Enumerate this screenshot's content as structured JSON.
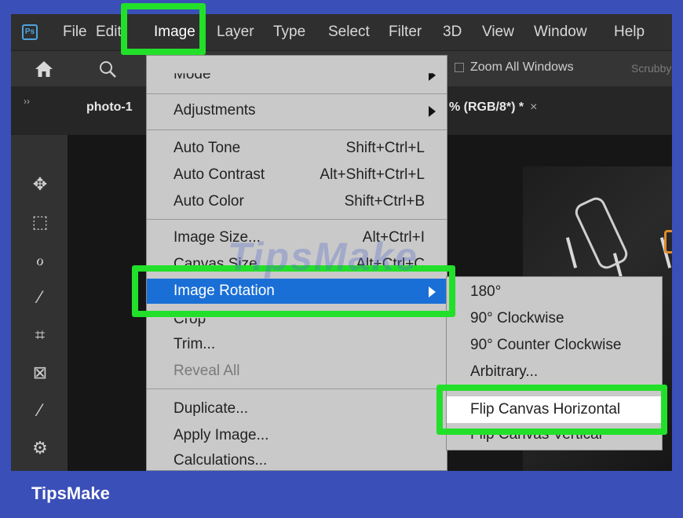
{
  "menubar": {
    "logo": "Ps",
    "items": [
      "File",
      "Edit",
      "Image",
      "Layer",
      "Type",
      "Select",
      "Filter",
      "3D",
      "View",
      "Window",
      "Help"
    ],
    "active": "Image"
  },
  "options": {
    "zoom_all_windows": "Zoom All Windows",
    "scrubby": "Scrubby"
  },
  "tabs": {
    "doc1": "photo-1",
    "doc2": "% (RGB/8*) *",
    "close": "×"
  },
  "image_menu": {
    "mode": "Mode",
    "adjustments": "Adjustments",
    "auto_tone": {
      "label": "Auto Tone",
      "shortcut": "Shift+Ctrl+L"
    },
    "auto_contrast": {
      "label": "Auto Contrast",
      "shortcut": "Alt+Shift+Ctrl+L"
    },
    "auto_color": {
      "label": "Auto Color",
      "shortcut": "Shift+Ctrl+B"
    },
    "image_size": {
      "label": "Image Size...",
      "shortcut": "Alt+Ctrl+I"
    },
    "canvas_size": {
      "label": "Canvas Size...",
      "shortcut": "Alt+Ctrl+C"
    },
    "image_rotation": "Image Rotation",
    "crop": "Crop",
    "trim": "Trim...",
    "reveal_all": "Reveal All",
    "duplicate": "Duplicate...",
    "apply_image": "Apply Image...",
    "calculations": "Calculations..."
  },
  "rotation_submenu": {
    "items": [
      "180°",
      "90° Clockwise",
      "90° Counter Clockwise",
      "Arbitrary..."
    ],
    "flip_h": "Flip Canvas Horizontal",
    "flip_v": "Flip Canvas Vertical"
  },
  "watermark": "TipsMake",
  "footer": {
    "brand": "TipsMake"
  },
  "colors": {
    "highlight": "#22e02a",
    "menu_active": "#1a6fd6",
    "frame": "#3a4fb8"
  }
}
